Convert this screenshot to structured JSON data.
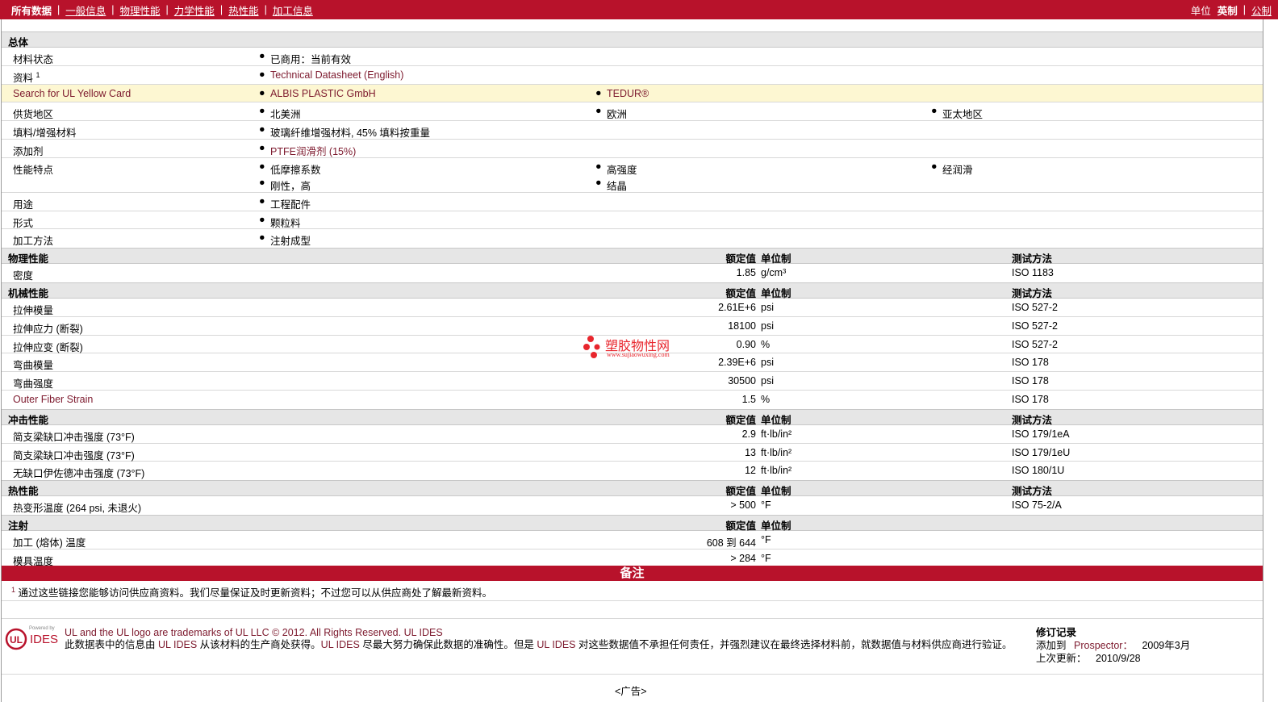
{
  "topbar": {
    "nav": [
      "所有数据",
      "一般信息",
      "物理性能",
      "力学性能",
      "热性能",
      "加工信息"
    ],
    "units_label": "单位",
    "unit_en": "英制",
    "unit_metric": "公制"
  },
  "general": {
    "title": "总体",
    "rows": [
      {
        "label": "材料状态",
        "cols": [
          [
            "已商用：当前有效"
          ]
        ]
      },
      {
        "label": "资料",
        "sup": "1",
        "cols": [
          [
            "Technical Datasheet (English)"
          ]
        ]
      },
      {
        "label": "Search for UL Yellow Card",
        "cols": [
          [
            "ALBIS PLASTIC GmbH"
          ],
          [
            "TEDUR®"
          ]
        ]
      },
      {
        "label": "供货地区",
        "cols": [
          [
            "北美洲"
          ],
          [
            "欧洲"
          ],
          [
            "亚太地区"
          ]
        ]
      },
      {
        "label": "填料/增强材料",
        "cols": [
          [
            "玻璃纤维增强材料, 45% 填料按重量"
          ]
        ]
      },
      {
        "label": "添加剂",
        "cols": [
          [
            "PTFE润滑剂 (15%)"
          ]
        ]
      },
      {
        "label": "性能特点",
        "cols": [
          [
            "低摩擦系数",
            "刚性，高"
          ],
          [
            "高强度",
            "结晶"
          ],
          [
            "经润滑"
          ]
        ]
      },
      {
        "label": "用途",
        "cols": [
          [
            "工程配件"
          ]
        ]
      },
      {
        "label": "形式",
        "cols": [
          [
            "颗粒料"
          ]
        ]
      },
      {
        "label": "加工方法",
        "cols": [
          [
            "注射成型"
          ]
        ]
      }
    ]
  },
  "headers": {
    "value": "额定值",
    "unit": "单位制",
    "test": "测试方法"
  },
  "physical": {
    "title": "物理性能",
    "rows": [
      {
        "label": "密度",
        "value": "1.85",
        "unit": "g/cm³",
        "test": "ISO 1183"
      }
    ]
  },
  "mechanical": {
    "title": "机械性能",
    "rows": [
      {
        "label": "拉伸模量",
        "value": "2.61E+6",
        "unit": "psi",
        "test": "ISO 527-2"
      },
      {
        "label": "拉伸应力 (断裂)",
        "value": "18100",
        "unit": "psi",
        "test": "ISO 527-2"
      },
      {
        "label": "拉伸应变 (断裂)",
        "value": "0.90",
        "unit": "%",
        "test": "ISO 527-2"
      },
      {
        "label": "弯曲模量",
        "value": "2.39E+6",
        "unit": "psi",
        "test": "ISO 178"
      },
      {
        "label": "弯曲强度",
        "value": "30500",
        "unit": "psi",
        "test": "ISO 178"
      },
      {
        "label": "Outer Fiber Strain",
        "value": "1.5",
        "unit": "%",
        "test": "ISO 178"
      }
    ]
  },
  "impact": {
    "title": "冲击性能",
    "rows": [
      {
        "label": "简支梁缺口冲击强度 (73°F)",
        "value": "2.9",
        "unit": "ft·lb/in²",
        "test": "ISO 179/1eA"
      },
      {
        "label": "简支梁缺口冲击强度 (73°F)",
        "value": "13",
        "unit": "ft·lb/in²",
        "test": "ISO 179/1eU"
      },
      {
        "label": "无缺口伊佐德冲击强度 (73°F)",
        "value": "12",
        "unit": "ft·lb/in²",
        "test": "ISO 180/1U"
      }
    ]
  },
  "thermal": {
    "title": "热性能",
    "rows": [
      {
        "label": "热变形温度 (264 psi, 未退火)",
        "value": "> 500",
        "unit": "°F",
        "test": "ISO 75-2/A"
      }
    ]
  },
  "injection": {
    "title": "注射",
    "rows": [
      {
        "label": "加工 (熔体) 温度",
        "value": "608 到  644",
        "unit": "°F",
        "test": ""
      },
      {
        "label": "模具温度",
        "value": "> 284",
        "unit": "°F",
        "test": ""
      }
    ]
  },
  "notes": {
    "title": "备注",
    "footnote_num": "1",
    "footnote": "通过这些链接您能够访问供应商资料。我们尽量保证及时更新资料；不过您可以从供应商处了解最新资料。"
  },
  "watermark": {
    "title": "塑胶物性网",
    "url": "www.sujiaowuxing.com"
  },
  "footer": {
    "logo_small": "Powered by",
    "logo_text": "IDES",
    "line1": "UL and the UL logo are trademarks of UL LLC © 2012. All Rights Reserved.",
    "line1_link": "UL IDES",
    "line2_a": "此数据表中的信息由",
    "line2_link1": "UL IDES",
    "line2_b": "从该材料的生产商处获得。",
    "line2_link2": "UL IDES",
    "line2_c": "尽最大努力确保此数据的准确性。但是",
    "line2_link3": "UL IDES",
    "line2_d": "对这些数据值不承担任何责任，并强烈建议在最终选择材料前，就数据值与材料供应商进行验证。",
    "rev_title": "修订记录",
    "rev_added_label": "添加到",
    "rev_added_where": "Prospector：",
    "rev_added_date": "2009年3月",
    "rev_updated_label": "上次更新：",
    "rev_updated_date": "2010/9/28",
    "ad": "<广告>"
  }
}
